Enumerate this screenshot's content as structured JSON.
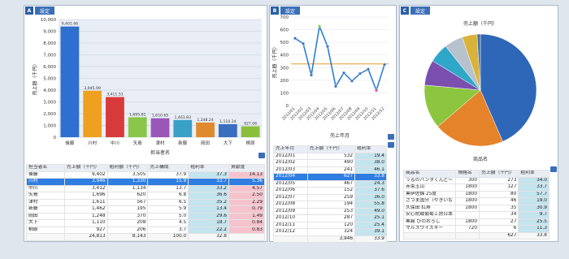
{
  "panels": {
    "a": {
      "letter": "A",
      "button": "設定"
    },
    "b": {
      "letter": "B",
      "button": "設定"
    },
    "c": {
      "letter": "C",
      "button": "設定"
    }
  },
  "chart_data": [
    {
      "type": "bar",
      "xlabel": "担当者名",
      "ylabel": "売上額（千円）",
      "ylim": [
        0,
        10000
      ],
      "yticks": [
        "10,000",
        "9,000",
        "8,000",
        "7,000",
        "6,000",
        "5,000",
        "4,000",
        "3,000",
        "2,000",
        "1,000",
        "0"
      ],
      "categories": [
        "後藤",
        "川村",
        "中川",
        "矢島",
        "津村",
        "新藤",
        "岡田",
        "大下",
        "桐原"
      ],
      "values": [
        9401.66,
        3945.99,
        3411.51,
        1695.81,
        1610.65,
        1461.83,
        1248.24,
        1110.24,
        927.06
      ],
      "labels": [
        "9,401.66",
        "3,945.99",
        "3,411.51",
        "1,695.81",
        "1,610.65",
        "1,461.83",
        "1,248.24",
        "1,110.24",
        "927.06"
      ],
      "colors": [
        "#2e6fd0",
        "#f0a020",
        "#d83a3a",
        "#8ac64a",
        "#9a57b8",
        "#3aa0c8",
        "#e08a30",
        "#3a6fc0",
        "#8bbf3a"
      ]
    },
    {
      "type": "line",
      "xlabel": "売上年月",
      "ylabel": "売上額（千円）",
      "ylim": [
        0,
        700
      ],
      "yticks": [
        "700",
        "600",
        "500",
        "400",
        "300",
        "200",
        "100",
        "0"
      ],
      "categories": [
        "2012/01",
        "2012/02",
        "2012/03",
        "2012/04",
        "2012/05",
        "2012/06",
        "2012/07",
        "2012/08",
        "2012/09",
        "2012/10",
        "2012/11",
        "2012/12"
      ],
      "values": [
        532,
        490,
        241,
        627,
        467,
        152,
        259,
        194,
        253,
        287,
        120,
        324
      ],
      "average": 329
    },
    {
      "type": "pie",
      "title": "売上額（千円）",
      "xlabel": "商品名",
      "values": [
        273,
        127,
        80,
        46,
        35,
        34,
        27,
        6
      ],
      "colors": [
        "#2e67b8",
        "#e5832a",
        "#8cc63f",
        "#7a4fb0",
        "#2fa7c9",
        "#b8c2cc",
        "#d9b23a",
        "#4a6fa0"
      ]
    }
  ],
  "table_a": {
    "headers": [
      "担当者名",
      "売上額（千円）",
      "粗利額（千円）",
      "売上構成",
      "粗利率",
      "貢献度"
    ],
    "rows": [
      [
        "後藤",
        "9,402",
        "3,505",
        "37.9",
        "37.3",
        "14.13"
      ],
      [
        "川村",
        "3,946",
        "1,330",
        "15.9",
        "33.7",
        "5.36"
      ],
      [
        "中川",
        "3,412",
        "1,134",
        "13.7",
        "33.2",
        "4.57"
      ],
      [
        "矢島",
        "1,696",
        "620",
        "6.8",
        "36.6",
        "2.50"
      ],
      [
        "津村",
        "1,611",
        "567",
        "6.5",
        "35.2",
        "2.29"
      ],
      [
        "新藤",
        "1,462",
        "195",
        "5.9",
        "13.4",
        "0.79"
      ],
      [
        "岡田",
        "1,248",
        "370",
        "5.0",
        "29.6",
        "1.49"
      ],
      [
        "大下",
        "1,110",
        "208",
        "4.5",
        "18.7",
        "0.84"
      ],
      [
        "桐原",
        "927",
        "206",
        "3.7",
        "22.2",
        "0.83"
      ]
    ],
    "total": [
      "",
      "24,813",
      "8,143",
      "100.0",
      "32.8",
      ""
    ]
  },
  "table_b": {
    "headers": [
      "売上年月",
      "売上額（千円）",
      "粗利率"
    ],
    "rows": [
      [
        "2012/01",
        "532",
        "19.4"
      ],
      [
        "2012/02",
        "490",
        "38.0"
      ],
      [
        "2012/03",
        "241",
        "46.1"
      ],
      [
        "2012/04",
        "627",
        "33.8"
      ],
      [
        "2012/05",
        "467",
        "24.3"
      ],
      [
        "2012/06",
        "152",
        "37.6"
      ],
      [
        "2012/07",
        "259",
        "36.0"
      ],
      [
        "2012/08",
        "194",
        "55.8"
      ],
      [
        "2012/09",
        "253",
        "49.0"
      ],
      [
        "2012/10",
        "287",
        "25.1"
      ],
      [
        "2012/11",
        "120",
        "25.4"
      ],
      [
        "2012/12",
        "324",
        "39.1"
      ]
    ],
    "total": [
      "",
      "3,946",
      "33.9"
    ]
  },
  "table_c": {
    "headers": [
      "商品名",
      "規格名",
      "売上額（千円）",
      "粗利率"
    ],
    "rows": [
      [
        "うるのパンダくんど〜",
        "300",
        "273",
        "34.0"
      ],
      [
        "赤兎玉山",
        "1800",
        "127",
        "33.7"
      ],
      [
        "黒伊佐錦 25度",
        "1800",
        "80",
        "57.7"
      ],
      [
        "さつま国分（やきいも",
        "1800",
        "46",
        "19.0"
      ],
      [
        "久保田 紅寿",
        "1800",
        "35",
        "30.9"
      ],
      [
        "安心院蔵葡萄工房日本",
        "",
        "34",
        "9.7"
      ],
      [
        "黒霧 ひのおろし",
        "1800",
        "27",
        "25.5"
      ],
      [
        "マルスウイスキー",
        "720",
        "6",
        "11.3"
      ]
    ],
    "total": [
      "",
      "",
      "627",
      "33.8"
    ]
  }
}
